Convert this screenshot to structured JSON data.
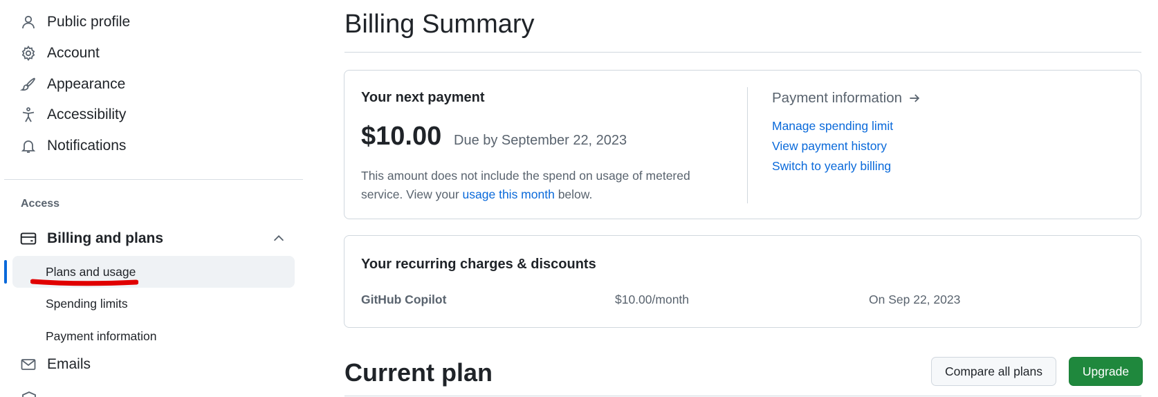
{
  "sidebar": {
    "items": [
      {
        "label": "Public profile",
        "icon": "person-icon"
      },
      {
        "label": "Account",
        "icon": "gear-icon"
      },
      {
        "label": "Appearance",
        "icon": "paintbrush-icon"
      },
      {
        "label": "Accessibility",
        "icon": "accessibility-icon"
      },
      {
        "label": "Notifications",
        "icon": "bell-icon"
      }
    ],
    "section_title": "Access",
    "billing": {
      "label": "Billing and plans",
      "icon": "credit-card-icon",
      "expanded": true
    },
    "sub_items": [
      {
        "label": "Plans and usage",
        "active": true
      },
      {
        "label": "Spending limits",
        "active": false
      },
      {
        "label": "Payment information",
        "active": false
      }
    ],
    "emails": {
      "label": "Emails",
      "icon": "mail-icon"
    }
  },
  "main": {
    "title": "Billing Summary",
    "next_payment": {
      "heading": "Your next payment",
      "amount": "$10.00",
      "due": "Due by September 22, 2023",
      "note_prefix": "This amount does not include the spend on usage of metered service. View your ",
      "note_link": "usage this month",
      "note_suffix": " below."
    },
    "payment_info": {
      "heading": "Payment information",
      "links": [
        "Manage spending limit",
        "View payment history",
        "Switch to yearly billing"
      ]
    },
    "recurring": {
      "heading": "Your recurring charges & discounts",
      "row": {
        "name": "GitHub Copilot",
        "price": "$10.00/month",
        "date": "On Sep 22, 2023"
      }
    },
    "current_plan": {
      "title": "Current plan",
      "compare_label": "Compare all plans",
      "upgrade_label": "Upgrade"
    }
  },
  "colors": {
    "link": "#0969da",
    "upgrade_button": "#1f883d",
    "active_bar": "#0969da",
    "annotation_underline": "#e00000"
  }
}
